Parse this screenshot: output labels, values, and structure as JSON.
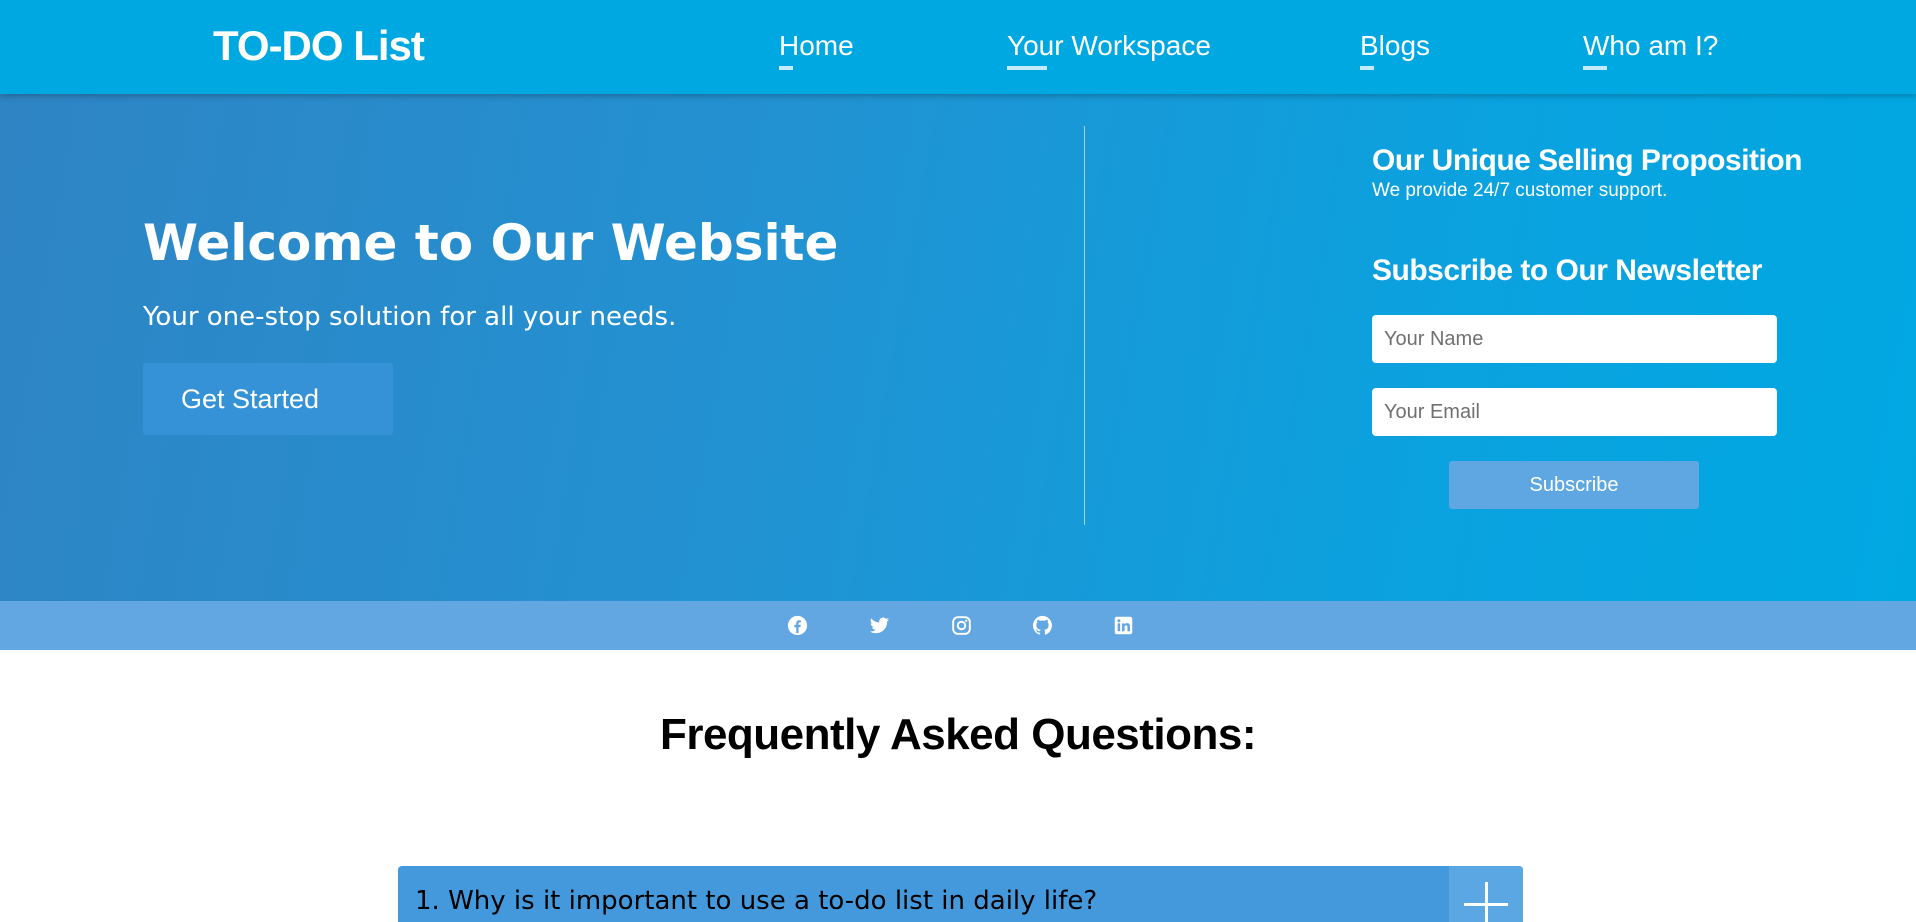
{
  "header": {
    "logo": "TO-DO List",
    "nav": [
      {
        "label": "Home"
      },
      {
        "label": "Your Workspace"
      },
      {
        "label": "Blogs"
      },
      {
        "label": "Who am I?"
      }
    ]
  },
  "hero": {
    "title": "Welcome to Our Website",
    "subtitle": "Your one-stop solution for all your needs.",
    "cta_label": "Get Started"
  },
  "sidebar": {
    "usp_title": "Our Unique Selling Proposition",
    "usp_text": "We provide 24/7 customer support.",
    "newsletter_title": "Subscribe to Our Newsletter",
    "name_placeholder": "Your Name",
    "email_placeholder": "Your Email",
    "subscribe_label": "Subscribe"
  },
  "social": {
    "icons": [
      "facebook-icon",
      "twitter-icon",
      "instagram-icon",
      "github-icon",
      "linkedin-icon"
    ]
  },
  "faq": {
    "title": "Frequently Asked Questions:",
    "items": [
      {
        "question": "1. Why is it important to use a to-do list in daily life?"
      }
    ]
  },
  "colors": {
    "header_bg": "#00a8e2",
    "hero_gradient_start": "#2f84c4",
    "hero_gradient_end": "#00a8e2",
    "cta_bg": "#3592d6",
    "subscribe_bg": "#5ea7e3",
    "social_bar_bg": "#62a6e2",
    "faq_item_bg": "#4499dd"
  }
}
